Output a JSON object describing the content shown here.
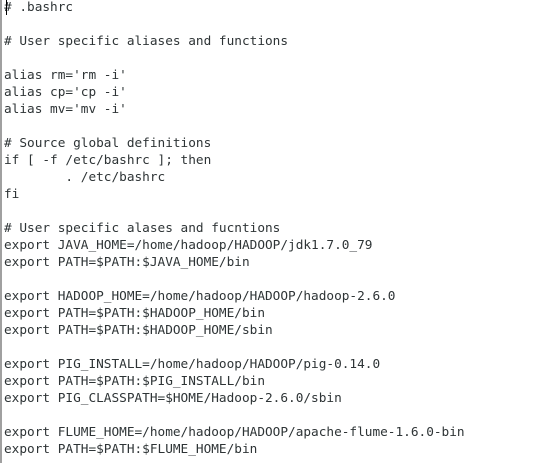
{
  "editor": {
    "lines": [
      "# .bashrc",
      "",
      "# User specific aliases and functions",
      "",
      "alias rm='rm -i'",
      "alias cp='cp -i'",
      "alias mv='mv -i'",
      "",
      "# Source global definitions",
      "if [ -f /etc/bashrc ]; then",
      "        . /etc/bashrc",
      "fi",
      "",
      "# User specific alases and fucntions",
      "export JAVA_HOME=/home/hadoop/HADOOP/jdk1.7.0_79",
      "export PATH=$PATH:$JAVA_HOME/bin",
      "",
      "export HADOOP_HOME=/home/hadoop/HADOOP/hadoop-2.6.0",
      "export PATH=$PATH:$HADOOP_HOME/bin",
      "export PATH=$PATH:$HADOOP_HOME/sbin",
      "",
      "export PIG_INSTALL=/home/hadoop/HADOOP/pig-0.14.0",
      "export PATH=$PATH:$PIG_INSTALL/bin",
      "export PIG_CLASSPATH=$HOME/Hadoop-2.6.0/sbin",
      "",
      "export FLUME_HOME=/home/hadoop/HADOOP/apache-flume-1.6.0-bin",
      "export PATH=$PATH:$FLUME_HOME/bin"
    ]
  }
}
